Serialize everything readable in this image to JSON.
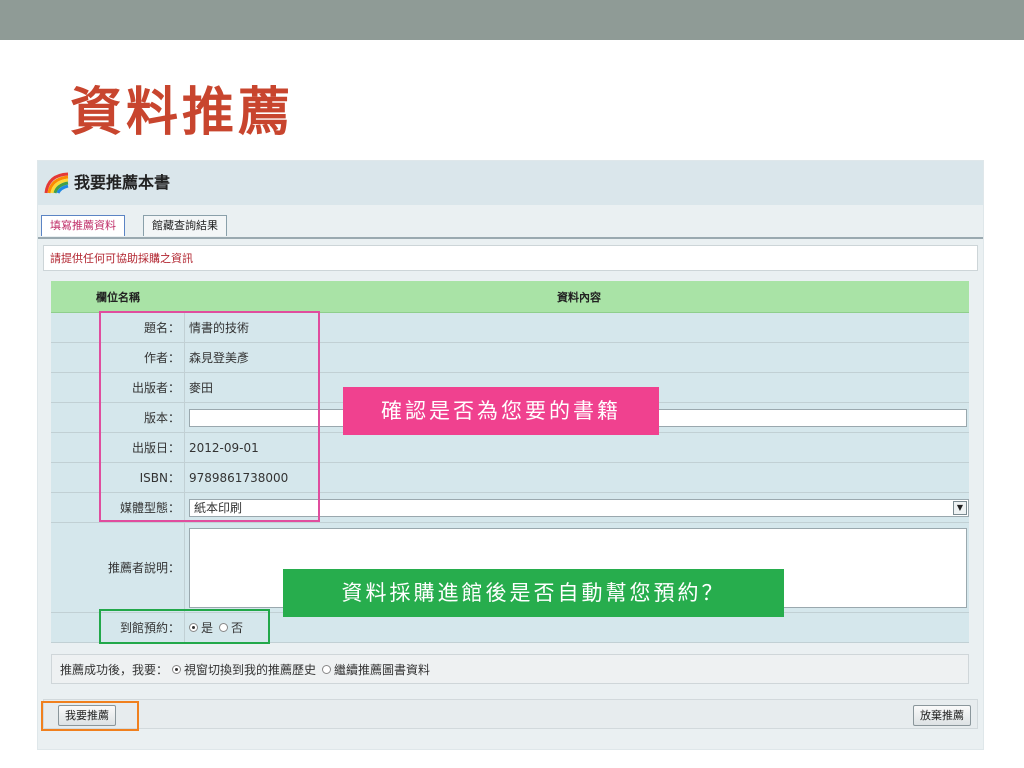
{
  "slide": {
    "title": "資料推薦"
  },
  "panel": {
    "title": "我要推薦本書",
    "tabs": [
      {
        "label": "填寫推薦資料"
      },
      {
        "label": "館藏查詢結果"
      }
    ],
    "notice": "請提供任何可協助採購之資訊"
  },
  "form": {
    "header": {
      "field_col": "欄位名稱",
      "value_col": "資料內容"
    },
    "title": {
      "label": "題名：",
      "value": "情書的技術"
    },
    "author": {
      "label": "作者：",
      "value": "森見登美彥"
    },
    "publisher": {
      "label": "出版者：",
      "value": "麥田"
    },
    "edition": {
      "label": "版本：",
      "value": ""
    },
    "pub_date": {
      "label": "出版日：",
      "value": "2012-09-01"
    },
    "isbn": {
      "label": "ISBN：",
      "value": "9789861738000"
    },
    "media_type": {
      "label": "媒體型態：",
      "value": "紙本印刷"
    },
    "reason": {
      "label": "推薦者說明：",
      "value": ""
    },
    "reserve": {
      "label": "到館預約：",
      "option_yes": "是",
      "option_no": "否",
      "selected": "是"
    }
  },
  "after_success": {
    "label": "推薦成功後，我要：",
    "option_1": "視窗切換到我的推薦歷史",
    "option_2": "繼續推薦圖書資料",
    "selected": "視窗切換到我的推薦歷史"
  },
  "buttons": {
    "submit": "我要推薦",
    "give_up": "放棄推薦"
  },
  "callouts": {
    "confirm_book": "確認是否為您要的書籍",
    "auto_reserve": "資料採購進館後是否自動幫您預約？"
  },
  "colors": {
    "title_red": "#c8452e",
    "callout_pink": "#f0418f",
    "callout_green": "#27ad4d",
    "highlight_orange": "#f0801e",
    "header_green": "#a9e3a6"
  }
}
